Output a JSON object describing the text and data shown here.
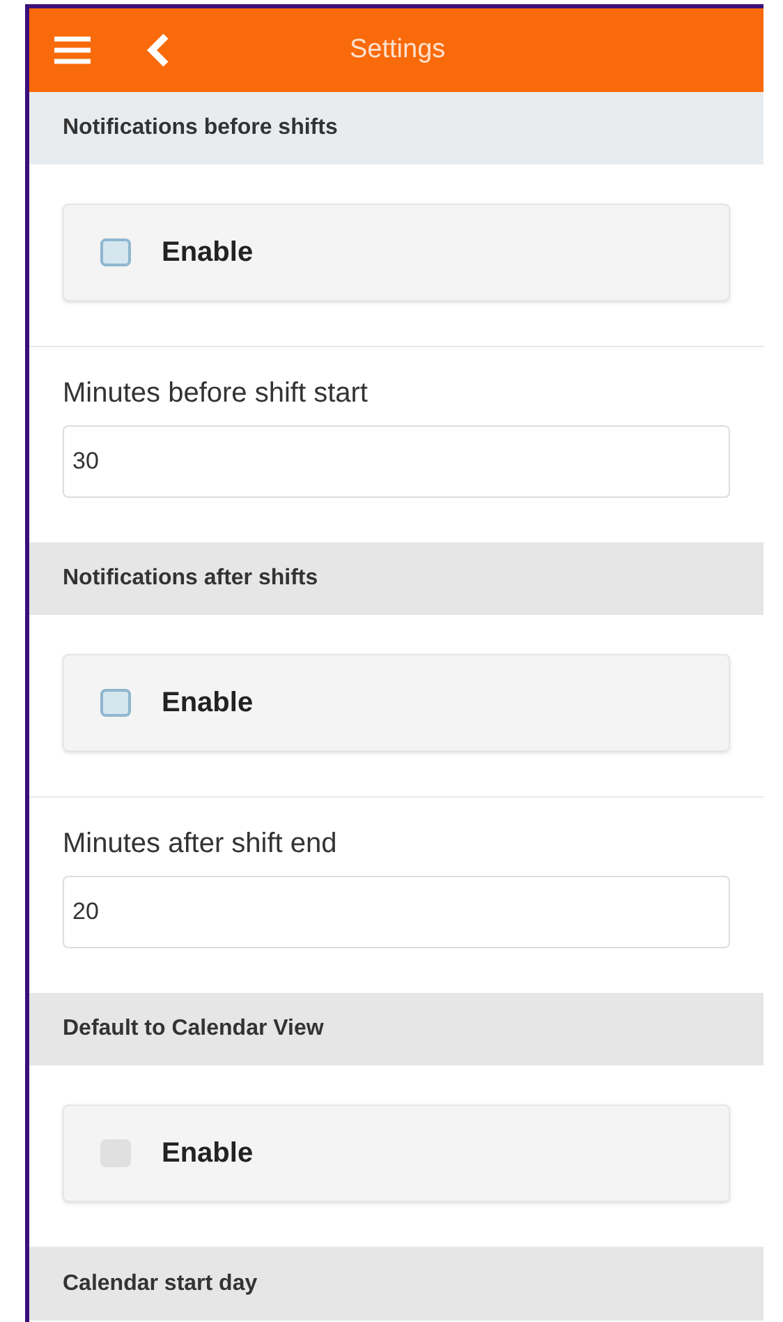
{
  "header": {
    "title": "Settings"
  },
  "sections": [
    {
      "title": "Notifications before shifts",
      "items": [
        {
          "kind": "checkbox",
          "label": "Enable",
          "checked": true
        },
        {
          "kind": "number",
          "label": "Minutes before shift start",
          "value": "30"
        }
      ]
    },
    {
      "title": "Notifications after shifts",
      "items": [
        {
          "kind": "checkbox",
          "label": "Enable",
          "checked": true
        },
        {
          "kind": "number",
          "label": "Minutes after shift end",
          "value": "20"
        }
      ]
    },
    {
      "title": "Default to Calendar View",
      "items": [
        {
          "kind": "checkbox",
          "label": "Enable",
          "checked": false
        }
      ]
    },
    {
      "title": "Calendar start day"
    }
  ]
}
